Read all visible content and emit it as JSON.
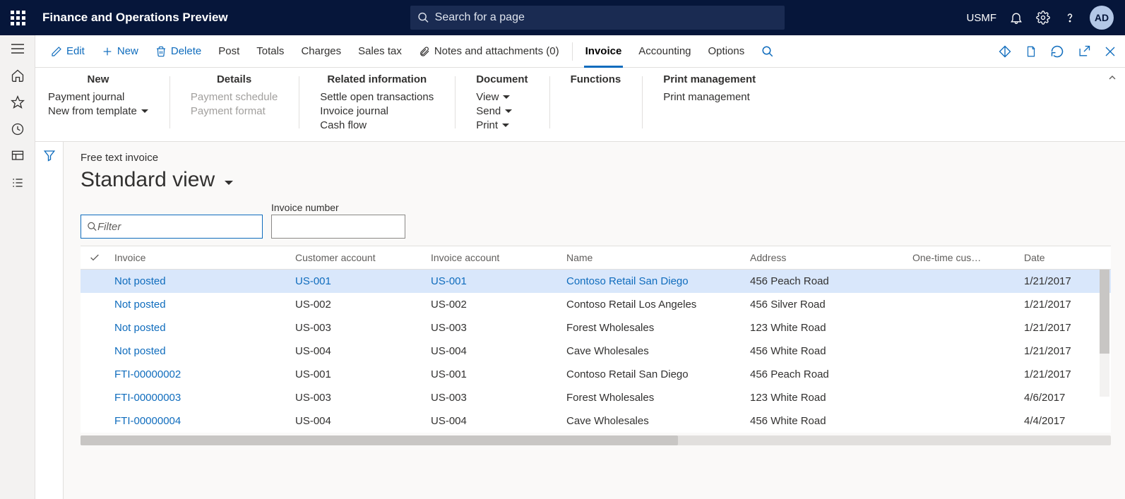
{
  "header": {
    "app_title": "Finance and Operations Preview",
    "search_placeholder": "Search for a page",
    "legal_entity": "USMF",
    "avatar_initials": "AD"
  },
  "actionbar": {
    "edit": "Edit",
    "new": "New",
    "delete": "Delete",
    "post": "Post",
    "totals": "Totals",
    "charges": "Charges",
    "sales_tax": "Sales tax",
    "notes": "Notes and attachments (0)",
    "invoice": "Invoice",
    "accounting": "Accounting",
    "options": "Options"
  },
  "ribbon": {
    "groups": [
      {
        "title": "New",
        "items": [
          {
            "label": "Payment journal"
          },
          {
            "label": "New from template",
            "chev": true
          }
        ]
      },
      {
        "title": "Details",
        "items": [
          {
            "label": "Payment schedule",
            "disabled": true
          },
          {
            "label": "Payment format",
            "disabled": true
          }
        ]
      },
      {
        "title": "Related information",
        "items": [
          {
            "label": "Settle open transactions"
          },
          {
            "label": "Invoice journal"
          },
          {
            "label": "Cash flow"
          }
        ]
      },
      {
        "title": "Document",
        "items": [
          {
            "label": "View",
            "chev": true
          },
          {
            "label": "Send",
            "chev": true
          },
          {
            "label": "Print",
            "chev": true
          }
        ]
      },
      {
        "title": "Functions",
        "items": []
      },
      {
        "title": "Print management",
        "items": [
          {
            "label": "Print management"
          }
        ]
      }
    ]
  },
  "page": {
    "breadcrumb": "Free text invoice",
    "view_name": "Standard view",
    "filter_placeholder": "Filter",
    "invoice_number_label": "Invoice number",
    "invoice_number_value": ""
  },
  "grid": {
    "columns": [
      "Invoice",
      "Customer account",
      "Invoice account",
      "Name",
      "Address",
      "One-time cus…",
      "Date"
    ],
    "rows": [
      {
        "invoice": "Not posted",
        "cust": "US-001",
        "inv": "US-001",
        "name": "Contoso Retail San Diego",
        "addr": "456 Peach Road",
        "onetime": "",
        "date": "1/21/2017",
        "selected": true
      },
      {
        "invoice": "Not posted",
        "cust": "US-002",
        "inv": "US-002",
        "name": "Contoso Retail Los Angeles",
        "addr": "456 Silver Road",
        "onetime": "",
        "date": "1/21/2017"
      },
      {
        "invoice": "Not posted",
        "cust": "US-003",
        "inv": "US-003",
        "name": "Forest Wholesales",
        "addr": "123 White Road",
        "onetime": "",
        "date": "1/21/2017"
      },
      {
        "invoice": "Not posted",
        "cust": "US-004",
        "inv": "US-004",
        "name": "Cave Wholesales",
        "addr": "456 White Road",
        "onetime": "",
        "date": "1/21/2017"
      },
      {
        "invoice": "FTI-00000002",
        "cust": "US-001",
        "inv": "US-001",
        "name": "Contoso Retail San Diego",
        "addr": "456 Peach Road",
        "onetime": "",
        "date": "1/21/2017"
      },
      {
        "invoice": "FTI-00000003",
        "cust": "US-003",
        "inv": "US-003",
        "name": "Forest Wholesales",
        "addr": "123 White Road",
        "onetime": "",
        "date": "4/6/2017"
      },
      {
        "invoice": "FTI-00000004",
        "cust": "US-004",
        "inv": "US-004",
        "name": "Cave Wholesales",
        "addr": "456 White Road",
        "onetime": "",
        "date": "4/4/2017"
      }
    ]
  }
}
